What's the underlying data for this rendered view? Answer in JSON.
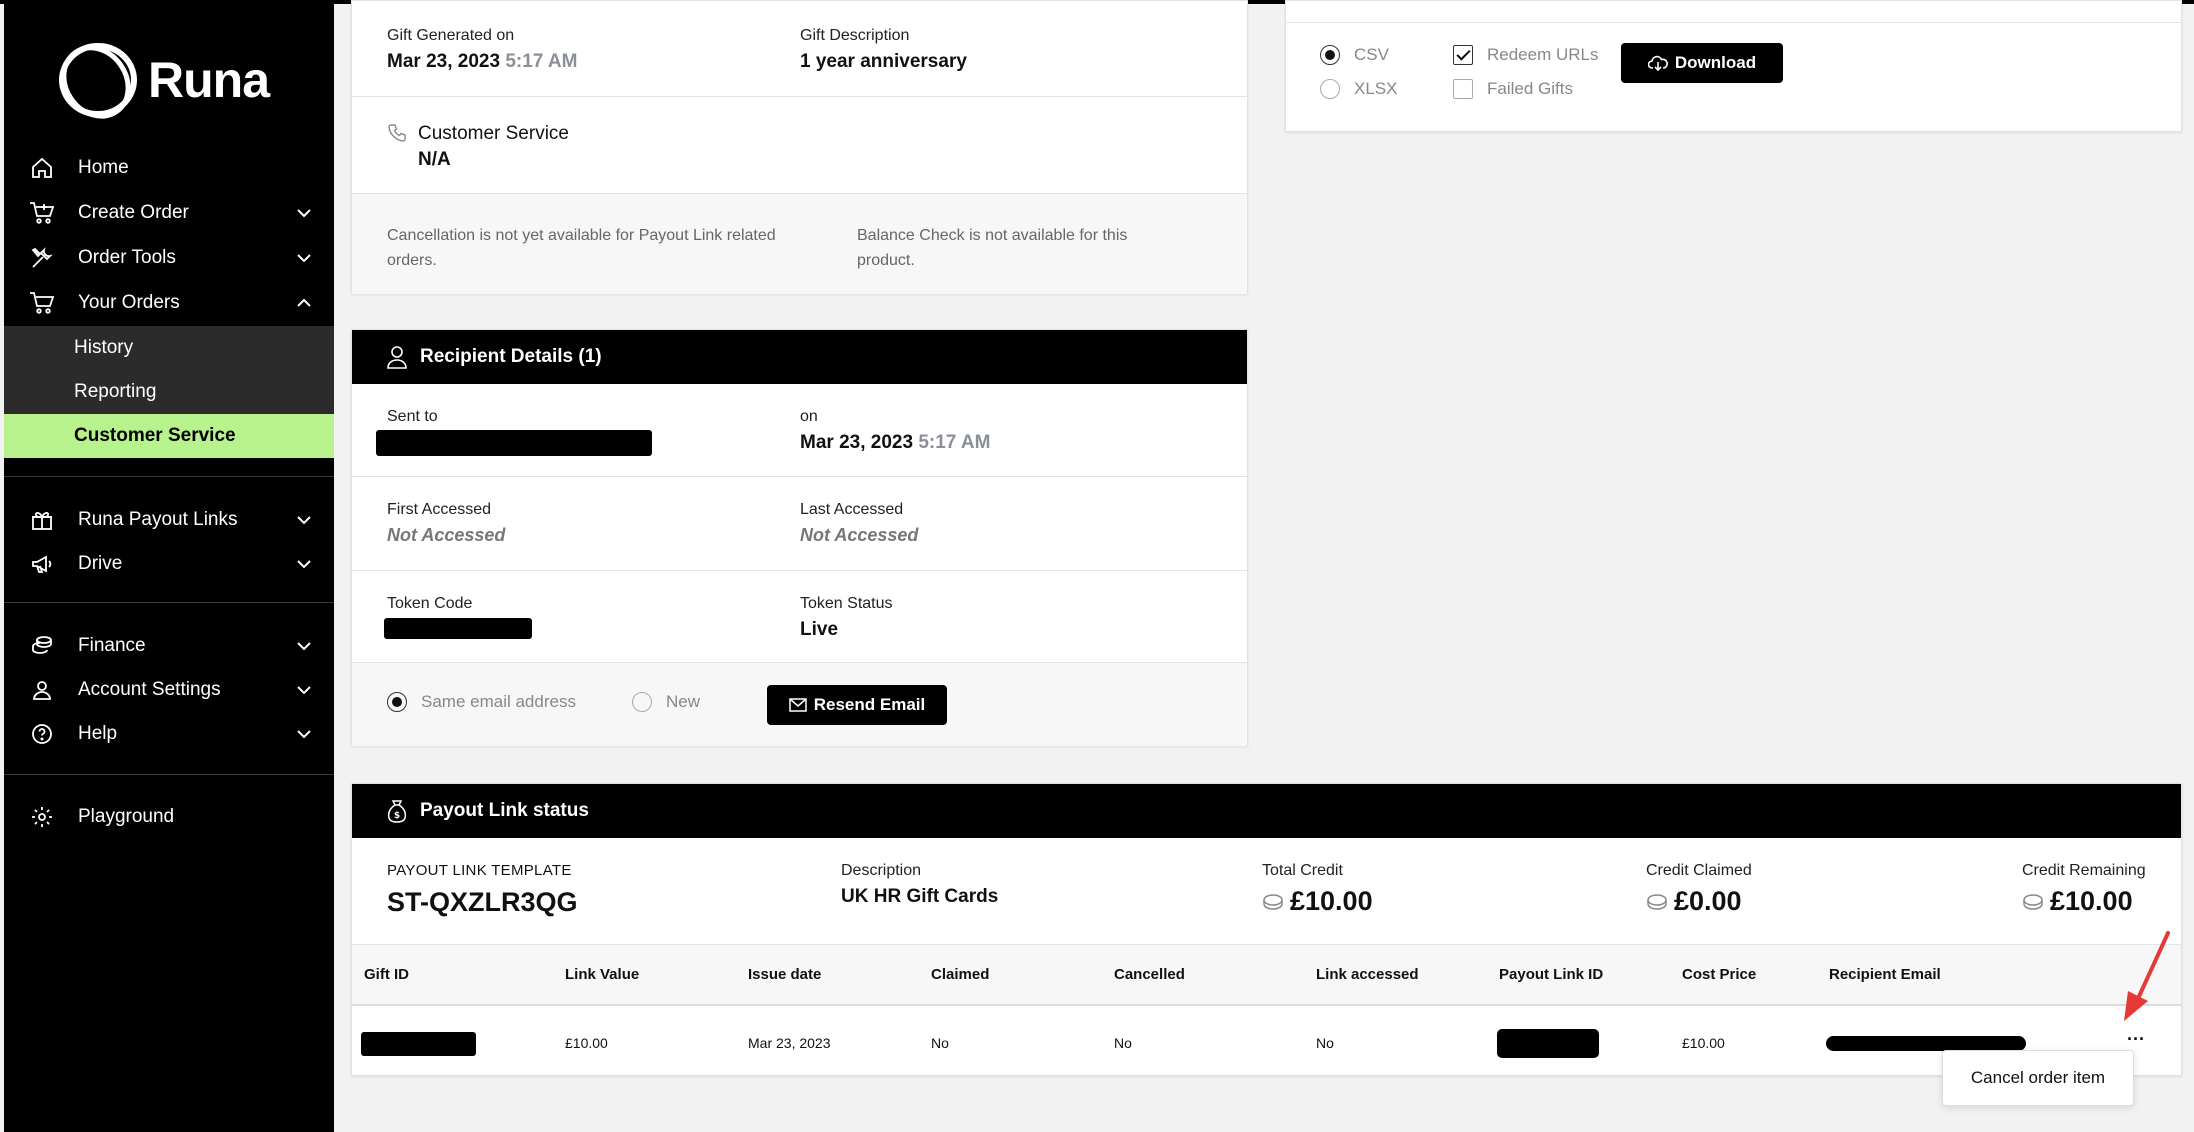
{
  "sidebar": {
    "logo_text": "Runa",
    "items": {
      "home": "Home",
      "create_order": "Create Order",
      "order_tools": "Order Tools",
      "your_orders": "Your Orders",
      "history": "History",
      "reporting": "Reporting",
      "customer_service": "Customer Service",
      "payout_links": "Runa Payout Links",
      "drive": "Drive",
      "finance": "Finance",
      "account_settings": "Account Settings",
      "help": "Help",
      "playground": "Playground"
    }
  },
  "gift_card": {
    "generated_label": "Gift Generated on",
    "generated_date": "Mar 23, 2023",
    "generated_time": "5:17 AM",
    "description_label": "Gift Description",
    "description_value": "1 year anniversary",
    "customer_service_label": "Customer Service",
    "customer_service_value": "N/A",
    "cancel_note": "Cancellation is not yet available for Payout Link related orders.",
    "balance_note": "Balance Check is not available for this product."
  },
  "download_card": {
    "csv": "CSV",
    "xlsx": "XLSX",
    "redeem_urls": "Redeem URLs",
    "failed_gifts": "Failed Gifts",
    "download_label": "Download"
  },
  "recipient": {
    "title": "Recipient Details (1)",
    "sent_to_label": "Sent to",
    "on_label": "on",
    "on_date": "Mar 23, 2023",
    "on_time": "5:17 AM",
    "first_accessed_label": "First Accessed",
    "first_accessed_value": "Not Accessed",
    "last_accessed_label": "Last Accessed",
    "last_accessed_value": "Not Accessed",
    "token_code_label": "Token Code",
    "token_status_label": "Token Status",
    "token_status_value": "Live",
    "same_email": "Same email address",
    "new": "New",
    "resend_label": "Resend Email"
  },
  "payout": {
    "title": "Payout Link status",
    "template_label": "PAYOUT LINK TEMPLATE",
    "template_value": "ST-QXZLR3QG",
    "description_label": "Description",
    "description_value": "UK HR Gift Cards",
    "total_credit_label": "Total Credit",
    "total_credit_value": "£10.00",
    "credit_claimed_label": "Credit Claimed",
    "credit_claimed_value": "£0.00",
    "credit_remaining_label": "Credit Remaining",
    "credit_remaining_value": "£10.00",
    "columns": {
      "gift_id": "Gift ID",
      "link_value": "Link Value",
      "issue_date": "Issue date",
      "claimed": "Claimed",
      "cancelled": "Cancelled",
      "link_accessed": "Link accessed",
      "payout_link_id": "Payout Link ID",
      "cost_price": "Cost Price",
      "recipient_email": "Recipient Email"
    },
    "row": {
      "link_value": "£10.00",
      "issue_date": "Mar 23, 2023",
      "claimed": "No",
      "cancelled": "No",
      "link_accessed": "No",
      "cost_price": "£10.00",
      "more": "···"
    },
    "menu_cancel": "Cancel order item"
  },
  "colors": {
    "accent": "#b8f28c",
    "arrow": "#e53935"
  }
}
